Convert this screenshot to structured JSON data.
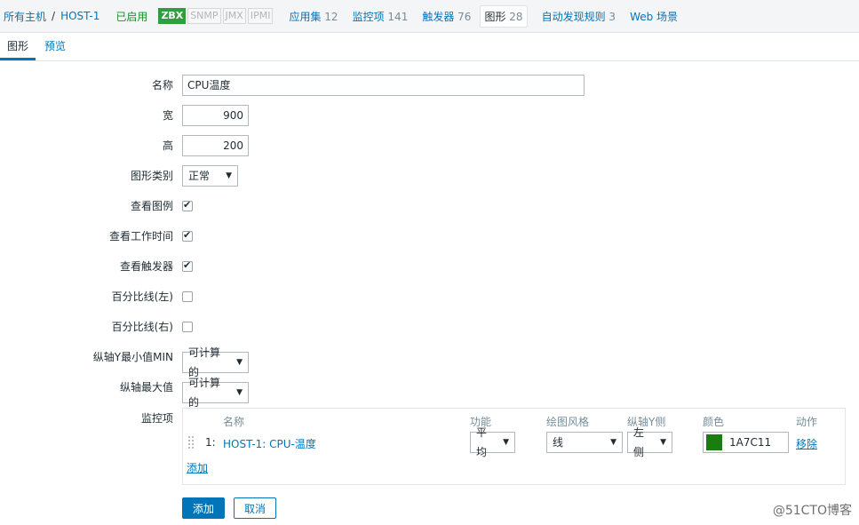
{
  "breadcrumb": {
    "all_hosts": "所有主机",
    "separator": "/",
    "host": "HOST-1",
    "status": "已启用",
    "protocols": [
      "ZBX",
      "SNMP",
      "JMX",
      "IPMI"
    ]
  },
  "nav": [
    {
      "label": "应用集",
      "count": "12"
    },
    {
      "label": "监控项",
      "count": "141"
    },
    {
      "label": "触发器",
      "count": "76"
    },
    {
      "label": "图形",
      "count": "28"
    },
    {
      "label": "自动发现规则",
      "count": "3"
    },
    {
      "label": "Web 场景",
      "count": ""
    }
  ],
  "tabs": [
    "图形",
    "预览"
  ],
  "form": {
    "name_label": "名称",
    "name_value": "CPU温度",
    "width_label": "宽",
    "width_value": "900",
    "height_label": "高",
    "height_value": "200",
    "graph_type_label": "图形类别",
    "graph_type_value": "正常",
    "show_legend_label": "查看图例",
    "show_work_period_label": "查看工作时间",
    "show_triggers_label": "查看触发器",
    "percentile_left_label": "百分比线(左)",
    "percentile_right_label": "百分比线(右)",
    "ymin_label": "纵轴Y最小值MIN",
    "ymin_value": "可计算的",
    "ymax_label": "纵轴最大值",
    "ymax_value": "可计算的",
    "items_label": "监控项"
  },
  "items": {
    "headers": [
      "名称",
      "功能",
      "绘图风格",
      "纵轴Y侧",
      "颜色",
      "动作"
    ],
    "rows": [
      {
        "num": "1:",
        "name": "HOST-1: CPU-温度",
        "function": "平均",
        "draw_style": "线",
        "y_side": "左侧",
        "color": "1A7C11",
        "action": "移除"
      }
    ],
    "add_label": "添加"
  },
  "buttons": {
    "add": "添加",
    "cancel": "取消"
  },
  "watermark": "@51CTO博客",
  "colors": {
    "accent": "#0275b8",
    "enabled": "#1d8f26",
    "item_color": "#1A7C11"
  }
}
